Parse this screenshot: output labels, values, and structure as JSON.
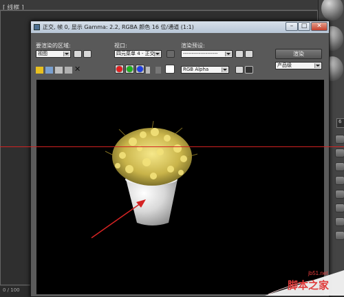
{
  "background": {
    "viewport_label": "[ 线框 ]",
    "frame_counter": "0 / 100"
  },
  "render_window": {
    "title": "正交, 帧 0, 显示 Gamma: 2.2, RGBA 颜色 16 位/通道 (1:1)",
    "controls": {
      "minimize": "–",
      "maximize": "□",
      "close": "✕"
    },
    "area_label": "要渲染的区域:",
    "area_value": "视图",
    "viewport_label": "视口:",
    "viewport_value": "四元菜单 4 - 正交",
    "preset_label": "渲染预设:",
    "preset_value": "--------------------",
    "render_button": "渲染",
    "quality_value": "产品级",
    "channel_value": "RGB Alpha"
  },
  "colors": {
    "swatch_red": "#e02020",
    "swatch_green": "#20b020",
    "swatch_blue": "#2040e0",
    "annotation": "#d42323"
  },
  "icons": [
    "save-icon",
    "copy-icon",
    "clone-icon",
    "print-icon",
    "clear-icon",
    "frame-icon",
    "region-icon",
    "lock-icon",
    "preset-icon",
    "teapot-icon",
    "mono-icon",
    "alpha-icon",
    "white-swatch-icon",
    "display-channel-icon",
    "toggle-ui-icon"
  ],
  "side_panel": {
    "spinner_value": "6"
  },
  "watermark": {
    "url": "jb51.net",
    "name": "脚本之家"
  }
}
